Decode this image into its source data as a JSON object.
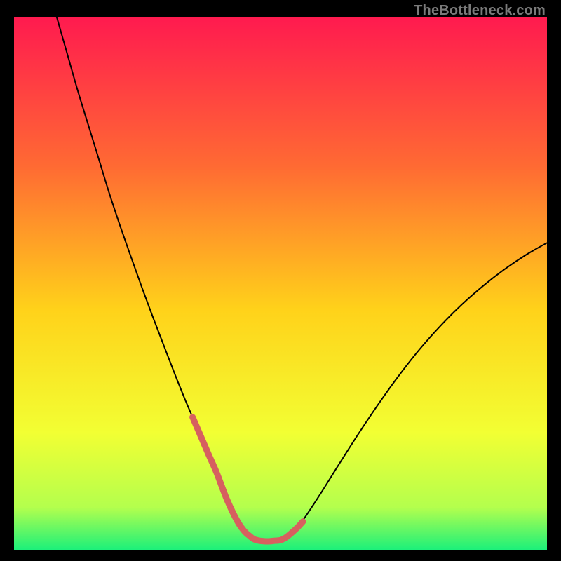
{
  "watermark": "TheBottleneck.com",
  "chart_data": {
    "type": "line",
    "title": "",
    "xlabel": "",
    "ylabel": "",
    "xlim": [
      0,
      100
    ],
    "ylim": [
      0,
      100
    ],
    "background_gradient": {
      "stops": [
        {
          "offset": 0.0,
          "color": "#ff1a4f"
        },
        {
          "offset": 0.28,
          "color": "#ff6a33"
        },
        {
          "offset": 0.55,
          "color": "#ffd21a"
        },
        {
          "offset": 0.78,
          "color": "#f2ff33"
        },
        {
          "offset": 0.92,
          "color": "#b4ff4d"
        },
        {
          "offset": 1.0,
          "color": "#1cf07a"
        }
      ]
    },
    "series": [
      {
        "name": "bottleneck-curve",
        "color": "#000000",
        "width": 2,
        "x": [
          8,
          10,
          12,
          14,
          16,
          18,
          20,
          22,
          24,
          26,
          28,
          30,
          32,
          33.5,
          35,
          36.5,
          38,
          40,
          42,
          44,
          45,
          46,
          48,
          50,
          52,
          54,
          56,
          58,
          60,
          64,
          68,
          72,
          76,
          80,
          84,
          88,
          92,
          96,
          100
        ],
        "y": [
          100,
          93,
          86,
          79.5,
          73,
          66.5,
          60.5,
          54.8,
          49.2,
          43.8,
          38.6,
          33.4,
          28.4,
          24.9,
          21.4,
          17.9,
          14.5,
          9.3,
          5.2,
          2.4,
          1.8,
          1.6,
          1.6,
          1.8,
          3.1,
          5.3,
          8.2,
          11.3,
          14.5,
          20.8,
          26.8,
          32.4,
          37.5,
          42.0,
          46.0,
          49.5,
          52.6,
          55.3,
          57.6
        ]
      },
      {
        "name": "minimum-highlight",
        "color": "#d6605f",
        "width": 9,
        "linecap": "round",
        "x": [
          33.5,
          35,
          36.5,
          38,
          40,
          42,
          43.3,
          44.2,
          45.0,
          46.0,
          47.0,
          48.0,
          49.0,
          50.0,
          51.0,
          52.0,
          53.2,
          54.2
        ],
        "y": [
          24.9,
          21.4,
          17.9,
          14.5,
          9.3,
          5.2,
          3.4,
          2.6,
          2.0,
          1.7,
          1.6,
          1.6,
          1.7,
          1.8,
          2.3,
          3.1,
          4.2,
          5.3
        ]
      }
    ]
  }
}
